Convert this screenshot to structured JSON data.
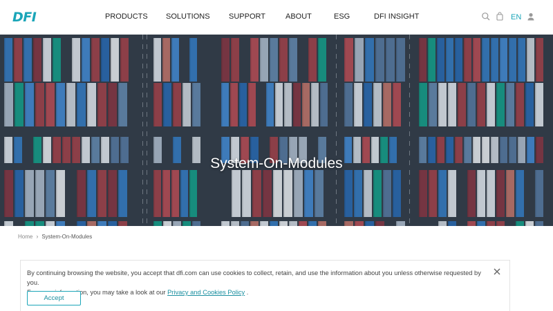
{
  "header": {
    "logo_text": "DFI",
    "nav": [
      "PRODUCTS",
      "SOLUTIONS",
      "SUPPORT",
      "ABOUT",
      "ESG",
      "DFI INSIGHT"
    ],
    "language": "EN",
    "icons": [
      "search-icon",
      "cart-icon",
      "user-icon"
    ]
  },
  "hero": {
    "title": "System-On-Modules",
    "image": "aerial-container-port"
  },
  "breadcrumb": {
    "home": "Home",
    "current": "System-On-Modules"
  },
  "cookie": {
    "line1": "By continuing browsing the website, you accept that dfi.com can use cookies to collect, retain, and use the information about you unless otherwise requested by you.",
    "line2_prefix": "For more information, you may take a look at our ",
    "link_text": "Privacy and Cookies Policy",
    "line2_suffix": " .",
    "accept_label": "Accept"
  },
  "colors": {
    "brand": "#1aa5b8",
    "text": "#222222"
  }
}
